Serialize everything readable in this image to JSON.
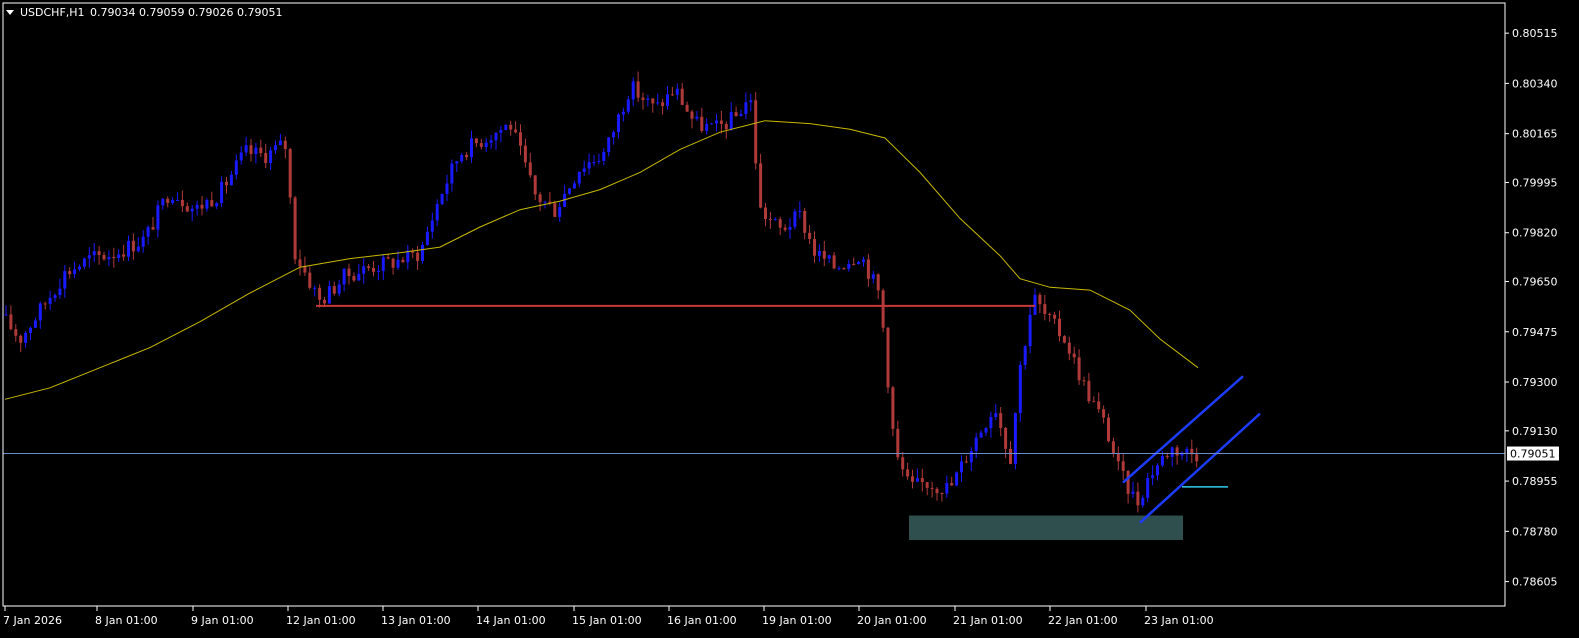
{
  "header": {
    "symbol_label": "USDCHF,H1",
    "ohlc_text": "0.79034 0.79059 0.79026 0.79051"
  },
  "colors": {
    "background": "#000000",
    "frame": "#ffffff",
    "bull_candle": "#1a1aff",
    "bear_candle": "#b03a3a",
    "moving_average": "#c8b800",
    "support_line": "#c83a3a",
    "channel": "#1e3cff",
    "cyan_line": "#33ccee",
    "demand_zone": "#2f4f4f",
    "current_price_line": "#6a8cc8"
  },
  "chart_data": {
    "type": "candlestick",
    "instrument": "USDCHF",
    "timeframe": "H1",
    "current_price": 0.79051,
    "ylim": [
      0.7852,
      0.8062
    ],
    "y_ticks": [
      "0.80515",
      "0.80340",
      "0.80165",
      "0.79995",
      "0.79820",
      "0.79650",
      "0.79475",
      "0.79300",
      "0.79130",
      "0.78955",
      "0.78780",
      "0.78605"
    ],
    "x_ticks": [
      "7 Jan 2026",
      "8 Jan 01:00",
      "9 Jan 01:00",
      "12 Jan 01:00",
      "13 Jan 01:00",
      "14 Jan 01:00",
      "15 Jan 01:00",
      "16 Jan 01:00",
      "19 Jan 01:00",
      "20 Jan 01:00",
      "21 Jan 01:00",
      "22 Jan 01:00",
      "23 Jan 01:00"
    ],
    "price_path": [
      [
        0,
        0.7956
      ],
      [
        25,
        0.7945
      ],
      [
        45,
        0.7955
      ],
      [
        70,
        0.7968
      ],
      [
        95,
        0.7973
      ],
      [
        120,
        0.7975
      ],
      [
        150,
        0.798
      ],
      [
        175,
        0.7997
      ],
      [
        200,
        0.799
      ],
      [
        225,
        0.7996
      ],
      [
        250,
        0.801
      ],
      [
        270,
        0.8009
      ],
      [
        290,
        0.8013
      ],
      [
        300,
        0.7975
      ],
      [
        325,
        0.7958
      ],
      [
        350,
        0.7967
      ],
      [
        375,
        0.797
      ],
      [
        400,
        0.7972
      ],
      [
        425,
        0.7975
      ],
      [
        445,
        0.7995
      ],
      [
        465,
        0.801
      ],
      [
        490,
        0.8015
      ],
      [
        515,
        0.802
      ],
      [
        540,
        0.7995
      ],
      [
        560,
        0.799
      ],
      [
        585,
        0.8005
      ],
      [
        610,
        0.801
      ],
      [
        635,
        0.8033
      ],
      [
        660,
        0.8025
      ],
      [
        680,
        0.8032
      ],
      [
        700,
        0.802
      ],
      [
        720,
        0.8018
      ],
      [
        740,
        0.8022
      ],
      [
        755,
        0.803
      ],
      [
        765,
        0.799
      ],
      [
        785,
        0.7983
      ],
      [
        805,
        0.7988
      ],
      [
        820,
        0.7975
      ],
      [
        840,
        0.797
      ],
      [
        865,
        0.7975
      ],
      [
        885,
        0.796
      ],
      [
        900,
        0.7905
      ],
      [
        915,
        0.7893
      ],
      [
        930,
        0.7895
      ],
      [
        955,
        0.7893
      ],
      [
        980,
        0.791
      ],
      [
        1000,
        0.7922
      ],
      [
        1015,
        0.7903
      ],
      [
        1025,
        0.7935
      ],
      [
        1038,
        0.796
      ],
      [
        1050,
        0.7953
      ],
      [
        1070,
        0.7945
      ],
      [
        1090,
        0.7928
      ],
      [
        1110,
        0.7915
      ],
      [
        1125,
        0.7898
      ],
      [
        1142,
        0.7888
      ],
      [
        1155,
        0.7898
      ],
      [
        1175,
        0.7907
      ],
      [
        1200,
        0.7905
      ]
    ],
    "moving_average": [
      [
        5,
        0.7924
      ],
      [
        50,
        0.7928
      ],
      [
        100,
        0.7935
      ],
      [
        150,
        0.7942
      ],
      [
        200,
        0.7951
      ],
      [
        250,
        0.7961
      ],
      [
        300,
        0.797
      ],
      [
        350,
        0.7973
      ],
      [
        400,
        0.7975
      ],
      [
        440,
        0.7977
      ],
      [
        480,
        0.7984
      ],
      [
        520,
        0.799
      ],
      [
        560,
        0.7993
      ],
      [
        600,
        0.7997
      ],
      [
        640,
        0.8003
      ],
      [
        680,
        0.8011
      ],
      [
        720,
        0.8017
      ],
      [
        765,
        0.8021
      ],
      [
        810,
        0.802
      ],
      [
        850,
        0.8018
      ],
      [
        885,
        0.8015
      ],
      [
        920,
        0.8003
      ],
      [
        960,
        0.7987
      ],
      [
        1000,
        0.7974
      ],
      [
        1020,
        0.7966
      ],
      [
        1050,
        0.7963
      ],
      [
        1090,
        0.7962
      ],
      [
        1130,
        0.7955
      ],
      [
        1160,
        0.7945
      ],
      [
        1198,
        0.7935
      ]
    ],
    "drawings": {
      "support_line": {
        "x1": 316,
        "x2": 1035,
        "price": 0.79565
      },
      "channel_upper": {
        "x1": 1123,
        "y1": 0.7895,
        "x2": 1243,
        "y2": 0.7932
      },
      "channel_lower": {
        "x1": 1140,
        "y1": 0.7881,
        "x2": 1260,
        "y2": 0.7919
      },
      "cyan_line": {
        "x1": 1182,
        "x2": 1228,
        "price": 0.78935
      },
      "demand_zone": {
        "x1": 909,
        "x2": 1183,
        "y_top": 0.78835,
        "y_bottom": 0.7875
      }
    }
  }
}
